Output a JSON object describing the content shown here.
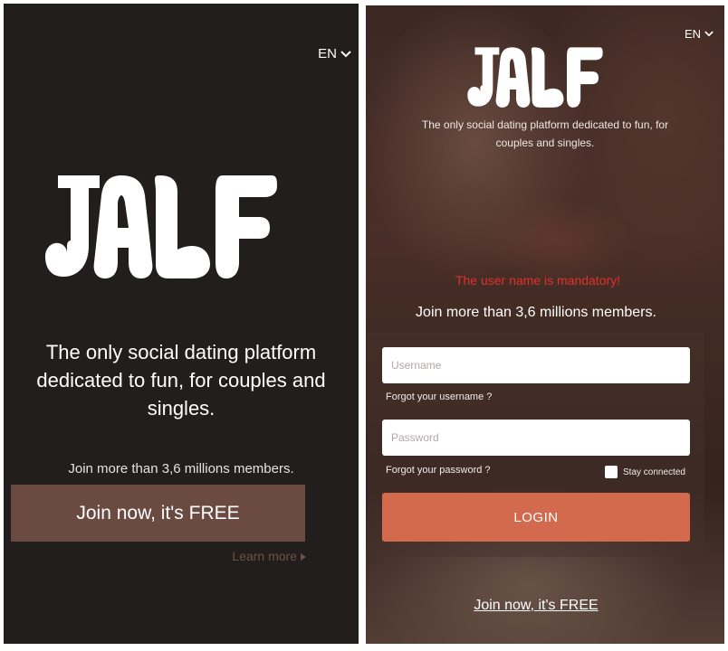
{
  "landing": {
    "language": "EN",
    "logo_text": "JALF",
    "tagline": "The only social dating platform dedicated to fun, for couples and singles.",
    "members": "Join more than 3,6 millions members.",
    "join_button": "Join now, it's FREE",
    "learn_more": "Learn more"
  },
  "login": {
    "language": "EN",
    "logo_text": "JALF",
    "tagline": "The only social dating platform dedicated to fun, for couples and singles.",
    "error": "The user name is mandatory!",
    "members": "Join more than 3,6 millions members.",
    "username_placeholder": "Username",
    "forgot_username": "Forgot your username ?",
    "password_placeholder": "Password",
    "forgot_password": "Forgot your password ?",
    "stay_connected": "Stay connected",
    "login_button": "LOGIN",
    "join_link": "Join now, it's FREE"
  },
  "colors": {
    "dark_bg": "#221e1e",
    "join_button": "#6b4a42",
    "login_button": "#d36a4e",
    "error": "#e0302a"
  }
}
